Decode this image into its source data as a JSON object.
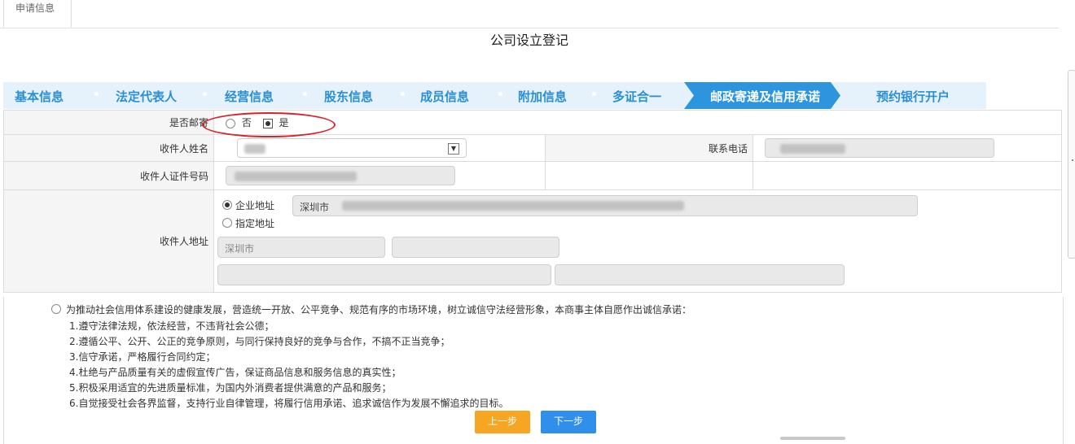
{
  "tab": {
    "label": "申请信息"
  },
  "page_title": "公司设立登记",
  "steps": [
    {
      "label": "基本信息"
    },
    {
      "label": "法定代表人"
    },
    {
      "label": "经营信息"
    },
    {
      "label": "股东信息"
    },
    {
      "label": "成员信息"
    },
    {
      "label": "附加信息"
    },
    {
      "label": "多证合一"
    },
    {
      "label": "邮政寄递及信用承诺",
      "active": true
    },
    {
      "label": "预约银行开户"
    }
  ],
  "form": {
    "mail": {
      "label": "是否邮寄",
      "option_no": "否",
      "option_yes": "是",
      "selected": "是"
    },
    "recipient_name": {
      "label": "收件人姓名",
      "value": "[redacted]"
    },
    "phone": {
      "label": "联系电话",
      "value": "[redacted]"
    },
    "recipient_id": {
      "label": "收件人证件号码",
      "value": "[redacted]"
    },
    "address": {
      "label": "收件人地址",
      "option_company": "企业地址",
      "option_custom": "指定地址",
      "selected": "企业地址",
      "company_address_value": "深圳市",
      "city_value": "深圳市"
    }
  },
  "commitment": {
    "intro": "为推动社会信用体系建设的健康发展，营造统一开放、公平竞争、规范有序的市场环境，树立诚信守法经营形象，本商事主体自愿作出诚信承诺：",
    "items": [
      "1.遵守法律法规，依法经营，不违背社会公德；",
      "2.遵循公平、公开、公正的竞争原则，与同行保持良好的竞争与合作，不搞不正当竞争；",
      "3.信守承诺，严格履行合同约定；",
      "4.杜绝与产品质量有关的虚假宣传广告，保证商品信息和服务信息的真实性；",
      "5.积极采用适宜的先进质量标准，为国内外消费者提供满意的产品和服务；",
      "6.自觉接受社会各界监督，支持行业自律管理，将履行信用承诺、追求诚信作为发展不懈追求的目标。"
    ]
  },
  "buttons": {
    "prev": "上一步",
    "next": "下一步"
  },
  "colors": {
    "accent": "#2d95de",
    "step_bg": "#e6f2fb",
    "prev_btn": "#f6a623",
    "next_btn": "#2f8fea",
    "highlight": "#d8232a"
  }
}
